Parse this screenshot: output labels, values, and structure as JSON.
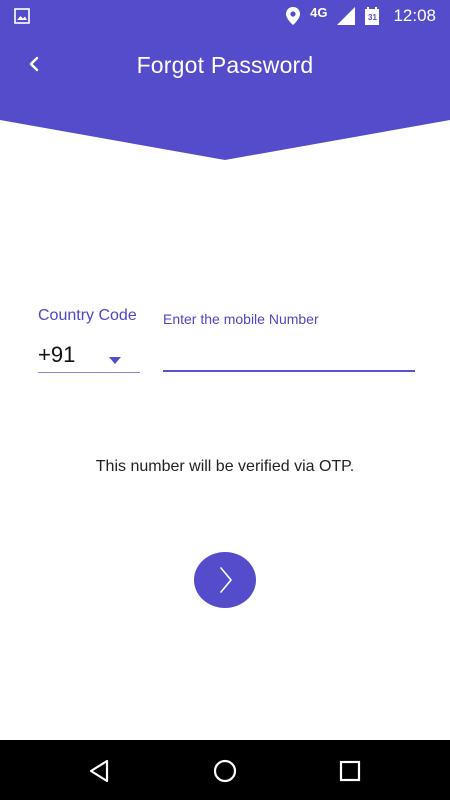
{
  "status_bar": {
    "left_icon": "image-icon",
    "location_icon": "location-pin-icon",
    "network": "4G",
    "signal_icon": "signal-icon",
    "calendar_icon": "calendar-icon",
    "calendar_day": "31",
    "time": "12:08"
  },
  "header": {
    "title": "Forgot Password",
    "back_icon": "chevron-left-icon",
    "color": "#554ccc"
  },
  "form": {
    "country_code_label": "Country Code",
    "country_code_value": "+91",
    "mobile_label": "Enter the mobile Number",
    "mobile_value": ""
  },
  "hint_text": "This number will be verified via OTP.",
  "next_button": {
    "icon": "chevron-right-icon"
  },
  "nav_bar": {
    "back": "back-triangle-icon",
    "home": "home-circle-icon",
    "recents": "recents-square-icon"
  }
}
